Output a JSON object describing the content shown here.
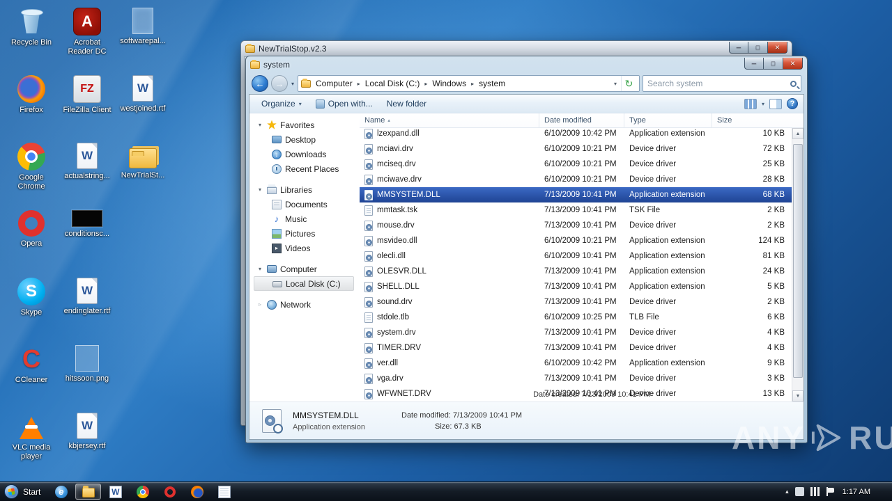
{
  "colors": {
    "selection": "#1f4494",
    "aero_glass": "#b4cce0",
    "desktop_top": "#2e7cc4",
    "desktop_bottom": "#0e3a70",
    "taskbar": "#10161f"
  },
  "desktop": {
    "columns": [
      [
        {
          "label": "Recycle Bin",
          "icon": "recycle"
        },
        {
          "label": "Firefox",
          "icon": "firefox"
        },
        {
          "label": "Google Chrome",
          "icon": "chrome"
        },
        {
          "label": "Opera",
          "icon": "opera"
        },
        {
          "label": "Skype",
          "icon": "skype"
        },
        {
          "label": "CCleaner",
          "icon": "ccleaner"
        },
        {
          "label": "VLC media player",
          "icon": "vlc"
        }
      ],
      [
        {
          "label": "Acrobat Reader DC",
          "icon": "acrobat"
        },
        {
          "label": "FileZilla Client",
          "icon": "filezilla"
        },
        {
          "label": "actualstring...",
          "icon": "worddoc"
        },
        {
          "label": "conditionsc...",
          "icon": "blackbox"
        },
        {
          "label": "endinglater.rtf",
          "icon": "worddoc"
        },
        {
          "label": "hitssoon.png",
          "icon": "imagefile"
        },
        {
          "label": "kbjersey.rtf",
          "icon": "worddoc"
        }
      ],
      [
        {
          "label": "softwarepal...",
          "icon": "ghostfile"
        },
        {
          "label": "westjoined.rtf",
          "icon": "worddoc"
        },
        {
          "label": "NewTrialSt...",
          "icon": "folder"
        }
      ]
    ]
  },
  "background_window": {
    "title": "NewTrialStop.v2.3"
  },
  "explorer_window": {
    "title": "system",
    "address": {
      "crumbs": [
        "Computer",
        "Local Disk (C:)",
        "Windows",
        "system"
      ],
      "search_placeholder": "Search system"
    },
    "toolbar": {
      "organize": "Organize",
      "open_with": "Open with...",
      "new_folder": "New folder"
    },
    "sidebar": [
      {
        "label": "Favorites",
        "icon": "star",
        "items": [
          {
            "label": "Desktop",
            "icon": "desktop"
          },
          {
            "label": "Downloads",
            "icon": "downloads"
          },
          {
            "label": "Recent Places",
            "icon": "recent"
          }
        ]
      },
      {
        "label": "Libraries",
        "icon": "libraries",
        "items": [
          {
            "label": "Documents",
            "icon": "documents"
          },
          {
            "label": "Music",
            "icon": "music"
          },
          {
            "label": "Pictures",
            "icon": "pictures"
          },
          {
            "label": "Videos",
            "icon": "videos"
          }
        ]
      },
      {
        "label": "Computer",
        "icon": "computer",
        "items": [
          {
            "label": "Local Disk (C:)",
            "icon": "disk",
            "selected": true
          }
        ]
      },
      {
        "label": "Network",
        "icon": "network",
        "items": []
      }
    ],
    "columns": [
      "Name",
      "Date modified",
      "Type",
      "Size"
    ],
    "files": [
      {
        "name": "lzexpand.dll",
        "modified": "6/10/2009 10:42 PM",
        "type": "Application extension",
        "size": "10 KB",
        "icon": "dll"
      },
      {
        "name": "mciavi.drv",
        "modified": "6/10/2009 10:21 PM",
        "type": "Device driver",
        "size": "72 KB",
        "icon": "dll"
      },
      {
        "name": "mciseq.drv",
        "modified": "6/10/2009 10:21 PM",
        "type": "Device driver",
        "size": "25 KB",
        "icon": "dll"
      },
      {
        "name": "mciwave.drv",
        "modified": "6/10/2009 10:21 PM",
        "type": "Device driver",
        "size": "28 KB",
        "icon": "dll"
      },
      {
        "name": "MMSYSTEM.DLL",
        "modified": "7/13/2009 10:41 PM",
        "type": "Application extension",
        "size": "68 KB",
        "icon": "dll",
        "selected": true
      },
      {
        "name": "mmtask.tsk",
        "modified": "7/13/2009 10:41 PM",
        "type": "TSK File",
        "size": "2 KB",
        "icon": "file"
      },
      {
        "name": "mouse.drv",
        "modified": "7/13/2009 10:41 PM",
        "type": "Device driver",
        "size": "2 KB",
        "icon": "dll"
      },
      {
        "name": "msvideo.dll",
        "modified": "6/10/2009 10:21 PM",
        "type": "Application extension",
        "size": "124 KB",
        "icon": "dll"
      },
      {
        "name": "olecli.dll",
        "modified": "6/10/2009 10:41 PM",
        "type": "Application extension",
        "size": "81 KB",
        "icon": "dll"
      },
      {
        "name": "OLESVR.DLL",
        "modified": "7/13/2009 10:41 PM",
        "type": "Application extension",
        "size": "24 KB",
        "icon": "dll"
      },
      {
        "name": "SHELL.DLL",
        "modified": "7/13/2009 10:41 PM",
        "type": "Application extension",
        "size": "5 KB",
        "icon": "dll"
      },
      {
        "name": "sound.drv",
        "modified": "7/13/2009 10:41 PM",
        "type": "Device driver",
        "size": "2 KB",
        "icon": "dll"
      },
      {
        "name": "stdole.tlb",
        "modified": "6/10/2009 10:25 PM",
        "type": "TLB File",
        "size": "6 KB",
        "icon": "file"
      },
      {
        "name": "system.drv",
        "modified": "7/13/2009 10:41 PM",
        "type": "Device driver",
        "size": "4 KB",
        "icon": "dll"
      },
      {
        "name": "TIMER.DRV",
        "modified": "7/13/2009 10:41 PM",
        "type": "Device driver",
        "size": "4 KB",
        "icon": "dll"
      },
      {
        "name": "ver.dll",
        "modified": "6/10/2009 10:42 PM",
        "type": "Application extension",
        "size": "9 KB",
        "icon": "dll"
      },
      {
        "name": "vga.drv",
        "modified": "7/13/2009 10:41 PM",
        "type": "Device driver",
        "size": "3 KB",
        "icon": "dll"
      },
      {
        "name": "WFWNET.DRV",
        "modified": "7/13/2009 10:41 PM",
        "type": "Device driver",
        "size": "13 KB",
        "icon": "dll"
      }
    ],
    "details": {
      "name": "MMSYSTEM.DLL",
      "type": "Application extension",
      "modified": "Date modified: 7/13/2009 10:41 PM",
      "size": "Size: 67.3 KB",
      "created": "Date created: 7/13/2009 10:41 PM"
    }
  },
  "taskbar": {
    "start_label": "Start",
    "buttons": [
      {
        "icon": "ie"
      },
      {
        "icon": "explorer",
        "active": true
      },
      {
        "icon": "word"
      },
      {
        "icon": "chrome"
      },
      {
        "icon": "opera"
      },
      {
        "icon": "firefox"
      },
      {
        "icon": "notepad"
      }
    ],
    "tray_time": "1:17 AM"
  },
  "watermark": {
    "left": "ANY",
    "right": "RUN"
  }
}
